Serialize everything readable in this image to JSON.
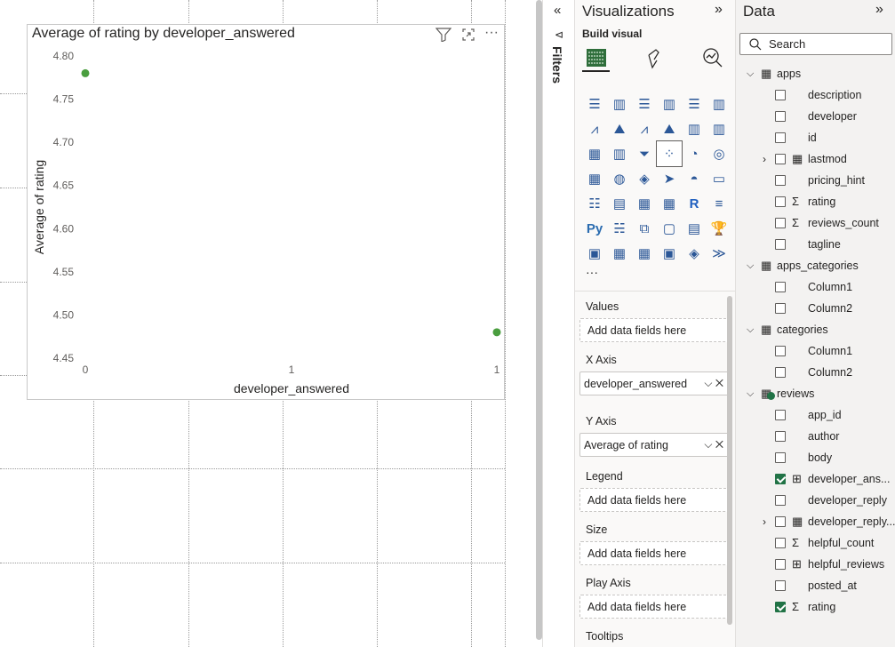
{
  "visual": {
    "title": "Average of rating by developer_answered",
    "filter_icon": "filter-icon",
    "focus_icon": "focus-mode-icon",
    "more_label": "···"
  },
  "chart_data": {
    "type": "scatter",
    "title": "Average of rating by developer_answered",
    "xlabel": "developer_answered",
    "ylabel": "Average of rating",
    "x_ticks": [
      "0",
      "1",
      "1"
    ],
    "y_ticks": [
      "4.80",
      "4.75",
      "4.70",
      "4.65",
      "4.60",
      "4.55",
      "4.50",
      "4.45"
    ],
    "ylim": [
      4.45,
      4.8
    ],
    "points": [
      {
        "x": 0,
        "y": 4.78
      },
      {
        "x": 1,
        "y": 4.48
      }
    ],
    "point_color": "#4a9e3f"
  },
  "filters": {
    "label": "Filters"
  },
  "viz": {
    "title": "Visualizations",
    "build_visual": "Build visual",
    "more": "···",
    "wells": [
      {
        "label": "Values",
        "value": "Add data fields here",
        "filled": false
      },
      {
        "label": "X Axis",
        "value": "developer_answered",
        "filled": true
      },
      {
        "label": "Y Axis",
        "value": "Average of rating",
        "filled": true
      },
      {
        "label": "Legend",
        "value": "Add data fields here",
        "filled": false
      },
      {
        "label": "Size",
        "value": "Add data fields here",
        "filled": false
      },
      {
        "label": "Play Axis",
        "value": "Add data fields here",
        "filled": false
      },
      {
        "label": "Tooltips",
        "value": "",
        "filled": false
      }
    ]
  },
  "data": {
    "title": "Data",
    "search_placeholder": "Search",
    "tables": [
      {
        "name": "apps",
        "fields": [
          {
            "name": "description",
            "icon": "",
            "checked": false,
            "expand": false
          },
          {
            "name": "developer",
            "icon": "",
            "checked": false,
            "expand": false
          },
          {
            "name": "id",
            "icon": "",
            "checked": false,
            "expand": false
          },
          {
            "name": "lastmod",
            "icon": "calendar",
            "checked": false,
            "expand": true
          },
          {
            "name": "pricing_hint",
            "icon": "",
            "checked": false,
            "expand": false
          },
          {
            "name": "rating",
            "icon": "sigma",
            "checked": false,
            "expand": false
          },
          {
            "name": "reviews_count",
            "icon": "sigma",
            "checked": false,
            "expand": false
          },
          {
            "name": "tagline",
            "icon": "",
            "checked": false,
            "expand": false
          }
        ]
      },
      {
        "name": "apps_categories",
        "fields": [
          {
            "name": "Column1",
            "icon": "",
            "checked": false,
            "expand": false
          },
          {
            "name": "Column2",
            "icon": "",
            "checked": false,
            "expand": false
          }
        ]
      },
      {
        "name": "categories",
        "fields": [
          {
            "name": "Column1",
            "icon": "",
            "checked": false,
            "expand": false
          },
          {
            "name": "Column2",
            "icon": "",
            "checked": false,
            "expand": false
          }
        ]
      },
      {
        "name": "reviews",
        "fields": [
          {
            "name": "app_id",
            "icon": "",
            "checked": false,
            "expand": false
          },
          {
            "name": "author",
            "icon": "",
            "checked": false,
            "expand": false
          },
          {
            "name": "body",
            "icon": "",
            "checked": false,
            "expand": false
          },
          {
            "name": "developer_ans...",
            "icon": "calc",
            "checked": true,
            "expand": false
          },
          {
            "name": "developer_reply",
            "icon": "",
            "checked": false,
            "expand": false
          },
          {
            "name": "developer_reply...",
            "icon": "calendar",
            "checked": false,
            "expand": true
          },
          {
            "name": "helpful_count",
            "icon": "sigma",
            "checked": false,
            "expand": false
          },
          {
            "name": "helpful_reviews",
            "icon": "calc",
            "checked": false,
            "expand": false
          },
          {
            "name": "posted_at",
            "icon": "",
            "checked": false,
            "expand": false
          },
          {
            "name": "rating",
            "icon": "sigma",
            "checked": true,
            "expand": false
          }
        ]
      }
    ]
  }
}
